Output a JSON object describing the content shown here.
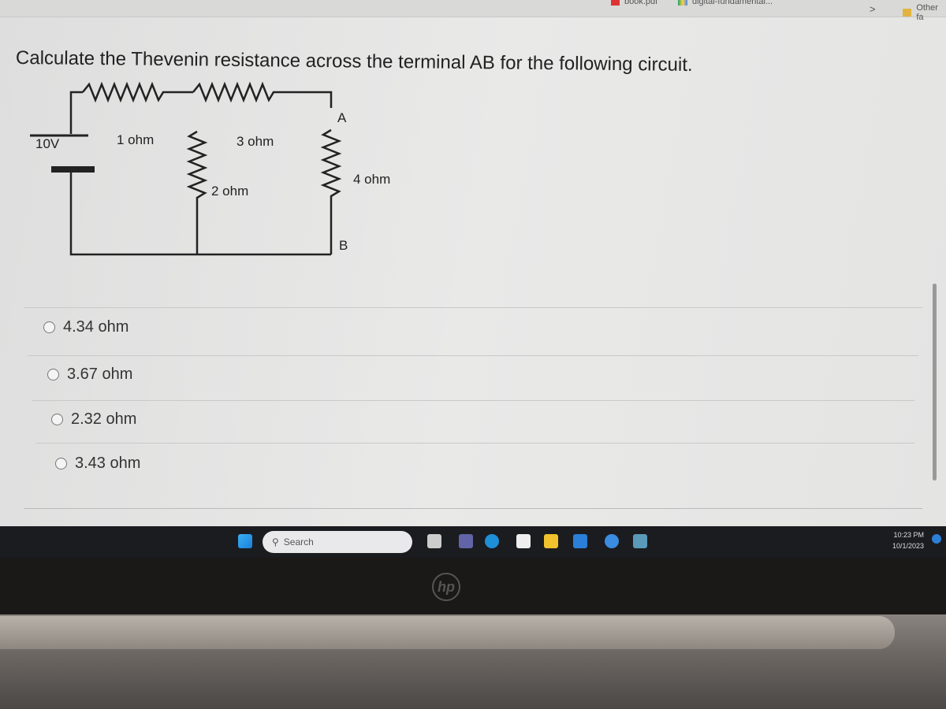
{
  "bookmarks_bar": {
    "items": [
      {
        "label": "book.pdf",
        "icon": "pdf-icon"
      },
      {
        "label": "digital-fundamental...",
        "icon": "google-drive-icon"
      }
    ],
    "overflow": ">",
    "other": "Other fa"
  },
  "question": {
    "text": "Calculate the Thevenin resistance across the terminal AB for the following circuit.",
    "circuit": {
      "source": "10V",
      "r1": "1 ohm",
      "r2": "3 ohm",
      "r3": "2 ohm",
      "r4": "4 ohm",
      "terminal_a": "A",
      "terminal_b": "B"
    }
  },
  "options": [
    {
      "label": "4.34 ohm",
      "selected": false
    },
    {
      "label": "3.67 ohm",
      "selected": false
    },
    {
      "label": "2.32 ohm",
      "selected": false
    },
    {
      "label": "3.43 ohm",
      "selected": false
    }
  ],
  "taskbar": {
    "search_placeholder": "Search",
    "time": "10:23 PM",
    "date": "10/1/2023",
    "apps": [
      "start-icon",
      "task-view-icon",
      "teams-icon",
      "edge-icon",
      "store-icon",
      "file-explorer-icon",
      "app-icon",
      "help-icon",
      "photos-icon"
    ]
  },
  "brand": "hp"
}
